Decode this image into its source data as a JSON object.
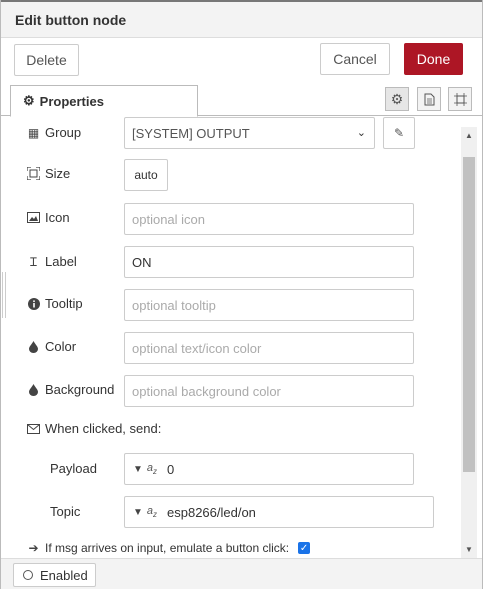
{
  "dialog": {
    "title": "Edit button node"
  },
  "toolbar": {
    "delete_label": "Delete",
    "cancel_label": "Cancel",
    "done_label": "Done"
  },
  "tabs": {
    "properties_label": "Properties"
  },
  "fields": {
    "group": {
      "label": "Group",
      "value": "[SYSTEM] OUTPUT"
    },
    "size": {
      "label": "Size",
      "value": "auto"
    },
    "icon": {
      "label": "Icon",
      "placeholder": "optional icon"
    },
    "label": {
      "label": "Label",
      "value": "ON"
    },
    "tooltip": {
      "label": "Tooltip",
      "placeholder": "optional tooltip"
    },
    "color": {
      "label": "Color",
      "placeholder": "optional text/icon color"
    },
    "background": {
      "label": "Background",
      "placeholder": "optional background color"
    },
    "when_clicked": {
      "label": "When clicked, send:"
    },
    "payload": {
      "label": "Payload",
      "type": "az",
      "value": "0"
    },
    "topic": {
      "label": "Topic",
      "type": "az",
      "value": "esp8266/led/on"
    },
    "emulate": {
      "label": "If msg arrives on input, emulate a button click:",
      "checked": true
    }
  },
  "footer": {
    "enabled_label": "Enabled"
  },
  "colors": {
    "done_button": "#ad1625",
    "checkbox": "#1a73e8"
  },
  "icons": [
    "cog-icon",
    "file-icon",
    "frame-icon",
    "table-icon",
    "resize-icon",
    "image-icon",
    "text-cursor-icon",
    "info-icon",
    "droplet-icon",
    "envelope-icon",
    "arrow-right-icon",
    "pencil-icon",
    "chevron-down-icon"
  ]
}
